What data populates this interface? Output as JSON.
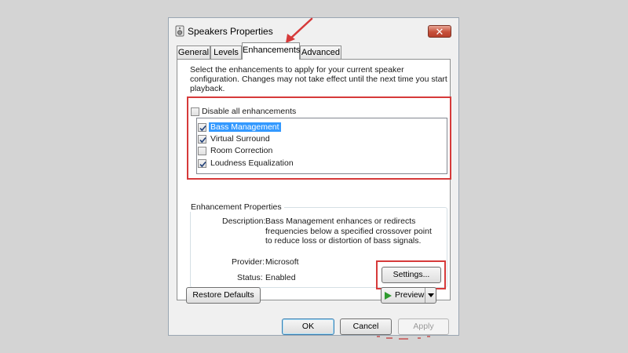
{
  "window": {
    "title": "Speakers Properties",
    "close_glyph": "✕"
  },
  "tabs": [
    {
      "label": "General"
    },
    {
      "label": "Levels"
    },
    {
      "label": "Enhancements",
      "active": true
    },
    {
      "label": "Advanced"
    }
  ],
  "enhancements": {
    "intro": "Select the enhancements to apply for your current speaker configuration. Changes may not take effect until the next time you start playback.",
    "disable_all": {
      "label": "Disable all enhancements",
      "checked": false
    },
    "items": [
      {
        "label": "Bass Management",
        "checked": true,
        "selected": true
      },
      {
        "label": "Virtual Surround",
        "checked": true
      },
      {
        "label": "Room Correction",
        "checked": false
      },
      {
        "label": "Loudness Equalization",
        "checked": true
      }
    ]
  },
  "properties": {
    "group_title": "Enhancement Properties",
    "description_label": "Description:",
    "description": "Bass Management enhances or redirects frequencies below a specified crossover point to reduce loss or distortion of bass signals.",
    "provider_label": "Provider:",
    "provider": "Microsoft",
    "status_label": "Status:",
    "status": "Enabled",
    "settings_button": "Settings..."
  },
  "footer": {
    "restore_defaults": "Restore Defaults",
    "preview": "Preview",
    "ok": "OK",
    "cancel": "Cancel",
    "apply": "Apply"
  },
  "colors": {
    "highlight": "#d63a3a",
    "selection": "#3399ff",
    "background": "#d4d4d4"
  },
  "icons": [
    "speaker-icon",
    "close-icon",
    "checkmark-icon",
    "play-icon",
    "dropdown-arrow-icon",
    "red-arrow-icon"
  ]
}
